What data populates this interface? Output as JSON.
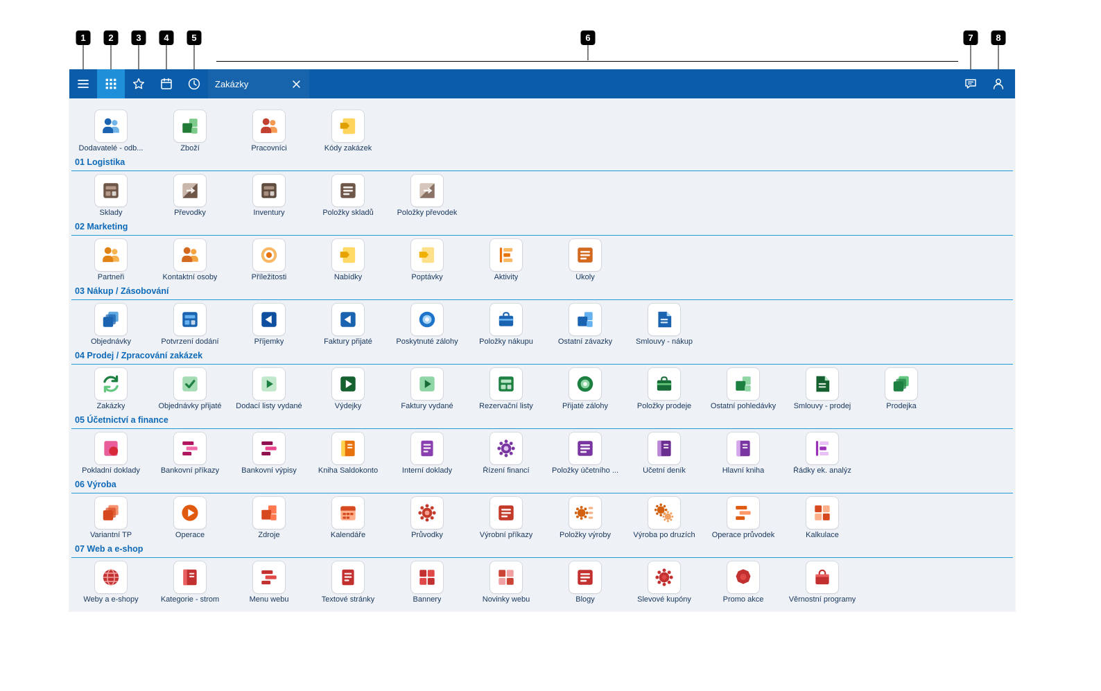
{
  "toolbar": {
    "tab": {
      "label": "Zakázky"
    },
    "icons": [
      "hamburger-menu-icon",
      "apps-grid-icon",
      "star-icon",
      "calendar-icon",
      "clock-icon",
      "chat-bubble-icon",
      "user-icon",
      "close-icon"
    ],
    "selected_button": "apps"
  },
  "callouts": [
    "1",
    "2",
    "3",
    "4",
    "5",
    "6",
    "7",
    "8"
  ],
  "colors": {
    "toolbar_bg": "#0b5ca9",
    "selected_button_bg": "#1e8fd8",
    "section_title": "#0e6ab8",
    "divider": "#1f9ad6",
    "tile_label": "#17365c",
    "content_bg": "#eef1f6",
    "callout": "#000000"
  },
  "sections": [
    {
      "header": null,
      "items": [
        {
          "label": "Dodavatelé - odb...",
          "icon": "people",
          "c1": "#1a63b0",
          "c2": "#6fb3e8"
        },
        {
          "label": "Zboží",
          "icon": "boxes",
          "c1": "#217a36",
          "c2": "#7ccb8a"
        },
        {
          "label": "Pracovníci",
          "icon": "people",
          "c1": "#c2402f",
          "c2": "#f59a52"
        },
        {
          "label": "Kódy zakázek",
          "icon": "tagdoc",
          "c1": "#e09f00",
          "c2": "#ffd45e"
        }
      ]
    },
    {
      "header": "01 Logistika",
      "items": [
        {
          "label": "Sklady",
          "icon": "window",
          "c1": "#6e5648",
          "c2": "#b59a8a"
        },
        {
          "label": "Převodky",
          "icon": "split",
          "c1": "#6e5648",
          "c2": "#cab6aa"
        },
        {
          "label": "Inventury",
          "icon": "window",
          "c1": "#5f4a3e",
          "c2": "#a88f80"
        },
        {
          "label": "Položky skladů",
          "icon": "list",
          "c1": "#6e5648",
          "c2": "#d5c5ba"
        },
        {
          "label": "Položky převodek",
          "icon": "split",
          "c1": "#8a7265",
          "c2": "#d5c5ba"
        }
      ]
    },
    {
      "header": "02 Marketing",
      "items": [
        {
          "label": "Partneři",
          "icon": "people",
          "c1": "#e08214",
          "c2": "#f6b24e"
        },
        {
          "label": "Kontaktní osoby",
          "icon": "people",
          "c1": "#d2691e",
          "c2": "#f4a340"
        },
        {
          "label": "Příležitosti",
          "icon": "target",
          "c1": "#e8720c",
          "c2": "#f8b864"
        },
        {
          "label": "Nabídky",
          "icon": "tagdoc",
          "c1": "#e8a200",
          "c2": "#ffd965"
        },
        {
          "label": "Poptávky",
          "icon": "tagdoc",
          "c1": "#f0b000",
          "c2": "#ffe08a"
        },
        {
          "label": "Aktivity",
          "icon": "flags",
          "c1": "#e8720c",
          "c2": "#f8b864"
        },
        {
          "label": "Úkoly",
          "icon": "list",
          "c1": "#d2691e",
          "c2": "#f5b041"
        }
      ]
    },
    {
      "header": "03 Nákup / Zásobování",
      "items": [
        {
          "label": "Objednávky",
          "icon": "layers",
          "c1": "#1a63b0",
          "c2": "#5fa8e0"
        },
        {
          "label": "Potvrzení dodání",
          "icon": "window",
          "c1": "#1a63b0",
          "c2": "#66b2f0"
        },
        {
          "label": "Příjemky",
          "icon": "play-left",
          "c1": "#0f4fa0",
          "c2": "#5fa8e0"
        },
        {
          "label": "Faktury přijaté",
          "icon": "play-left",
          "c1": "#1a63b0",
          "c2": "#7cc4f5"
        },
        {
          "label": "Poskytnuté zálohy",
          "icon": "coin",
          "c1": "#1e74c8",
          "c2": "#a8d4f5"
        },
        {
          "label": "Položky nákupu",
          "icon": "briefcase",
          "c1": "#1a63b0",
          "c2": "#66b2f0"
        },
        {
          "label": "Ostatní závazky",
          "icon": "boxes",
          "c1": "#1a63b0",
          "c2": "#66b2f0"
        },
        {
          "label": "Smlouvy - nákup",
          "icon": "fold",
          "c1": "#1a63b0",
          "c2": "#a8d4f5"
        }
      ]
    },
    {
      "header": "04 Prodej / Zpracování zakázek",
      "items": [
        {
          "label": "Zakázky",
          "icon": "sync",
          "c1": "#1d8040",
          "c2": "#63c77f"
        },
        {
          "label": "Objednávky přijaté",
          "icon": "check",
          "c1": "#1d8040",
          "c2": "#a5dcb4"
        },
        {
          "label": "Dodací listy vydané",
          "icon": "play",
          "c1": "#1d8040",
          "c2": "#c2e8cb"
        },
        {
          "label": "Výdejky",
          "icon": "play-dark",
          "c1": "#14602e",
          "c2": "#63c77f"
        },
        {
          "label": "Faktury vydané",
          "icon": "play",
          "c1": "#176b36",
          "c2": "#8fd6a4"
        },
        {
          "label": "Rezervační listy",
          "icon": "window",
          "c1": "#1d8040",
          "c2": "#b7e4c2"
        },
        {
          "label": "Přijaté zálohy",
          "icon": "coin",
          "c1": "#1d8040",
          "c2": "#8fd6a4"
        },
        {
          "label": "Položky prodeje",
          "icon": "briefcase",
          "c1": "#176b36",
          "c2": "#63c77f"
        },
        {
          "label": "Ostatní pohledávky",
          "icon": "boxes",
          "c1": "#1d8040",
          "c2": "#8fd6a4"
        },
        {
          "label": "Smlouvy - prodej",
          "icon": "fold",
          "c1": "#14602e",
          "c2": "#b7e4c2"
        },
        {
          "label": "Prodejka",
          "icon": "layers",
          "c1": "#1d8040",
          "c2": "#63c77f"
        }
      ]
    },
    {
      "header": "05 Účetnictví a finance",
      "items": [
        {
          "label": "Pokladní doklady",
          "icon": "docdot",
          "c1": "#d62839",
          "c2": "#e85d9a"
        },
        {
          "label": "Bankovní příkazy",
          "icon": "bars",
          "c1": "#b01560",
          "c2": "#ef6ca8"
        },
        {
          "label": "Bankovní výpisy",
          "icon": "bars",
          "c1": "#8e0f4e",
          "c2": "#e8478f"
        },
        {
          "label": "Kniha Saldokonto",
          "icon": "book",
          "c1": "#e8720c",
          "c2": "#ffd24d"
        },
        {
          "label": "Interní doklady",
          "icon": "doc",
          "c1": "#8a3fb0",
          "c2": "#d5a8ec"
        },
        {
          "label": "Řízení financí",
          "icon": "gear",
          "c1": "#7a36a0",
          "c2": "#e2c6f2"
        },
        {
          "label": "Položky účetního ...",
          "icon": "list",
          "c1": "#7a36a0",
          "c2": "#c89ce0"
        },
        {
          "label": "Účetní deník",
          "icon": "book",
          "c1": "#6a2d90",
          "c2": "#bb86d8"
        },
        {
          "label": "Hlavní kniha",
          "icon": "book",
          "c1": "#7a36a0",
          "c2": "#d5a8ec"
        },
        {
          "label": "Řádky ek. analýz",
          "icon": "flags",
          "c1": "#9a30b8",
          "c2": "#e8c2f4"
        }
      ]
    },
    {
      "header": "06 Výroba",
      "items": [
        {
          "label": "Variantní TP",
          "icon": "layers",
          "c1": "#d6491f",
          "c2": "#f79270"
        },
        {
          "label": "Operace",
          "icon": "play-circle",
          "c1": "#e05a10",
          "c2": "#ffb08a"
        },
        {
          "label": "Zdroje",
          "icon": "boxes",
          "c1": "#d6491f",
          "c2": "#ff7850"
        },
        {
          "label": "Kalendáře",
          "icon": "calendar",
          "c1": "#d6491f",
          "c2": "#ffb08a"
        },
        {
          "label": "Průvodky",
          "icon": "gear",
          "c1": "#c43a28",
          "c2": "#f5a08e"
        },
        {
          "label": "Výrobní příkazy",
          "icon": "list",
          "c1": "#c43a28",
          "c2": "#f8c0b4"
        },
        {
          "label": "Položky výroby",
          "icon": "gearlist",
          "c1": "#d2600e",
          "c2": "#f2b488"
        },
        {
          "label": "Výroba po druzích",
          "icon": "gears",
          "c1": "#d2600e",
          "c2": "#f0a060"
        },
        {
          "label": "Operace průvodek",
          "icon": "bars",
          "c1": "#e05a10",
          "c2": "#ff9868"
        },
        {
          "label": "Kalkulace",
          "icon": "grid",
          "c1": "#d6491f",
          "c2": "#ffb08a"
        }
      ]
    },
    {
      "header": "07 Web a e-shop",
      "items": [
        {
          "label": "Weby a e-shopy",
          "icon": "globe",
          "c1": "#c23030",
          "c2": "#f0a0a0"
        },
        {
          "label": "Kategorie - strom",
          "icon": "book",
          "c1": "#c23030",
          "c2": "#e86060"
        },
        {
          "label": "Menu webu",
          "icon": "bars",
          "c1": "#c23030",
          "c2": "#e04848"
        },
        {
          "label": "Textové stránky",
          "icon": "doc",
          "c1": "#c23030",
          "c2": "#f0a0a0"
        },
        {
          "label": "Bannery",
          "icon": "grid",
          "c1": "#c23030",
          "c2": "#e04848"
        },
        {
          "label": "Novinky webu",
          "icon": "grid",
          "c1": "#cb4335",
          "c2": "#f0a0a0"
        },
        {
          "label": "Blogy",
          "icon": "list",
          "c1": "#c23030",
          "c2": "#e86060"
        },
        {
          "label": "Slevové kupóny",
          "icon": "gear",
          "c1": "#c23030",
          "c2": "#e04848"
        },
        {
          "label": "Promo akce",
          "icon": "poly",
          "c1": "#c23030",
          "c2": "#e04848"
        },
        {
          "label": "Věrnostní programy",
          "icon": "bag",
          "c1": "#c23030",
          "c2": "#e86060"
        }
      ]
    }
  ]
}
